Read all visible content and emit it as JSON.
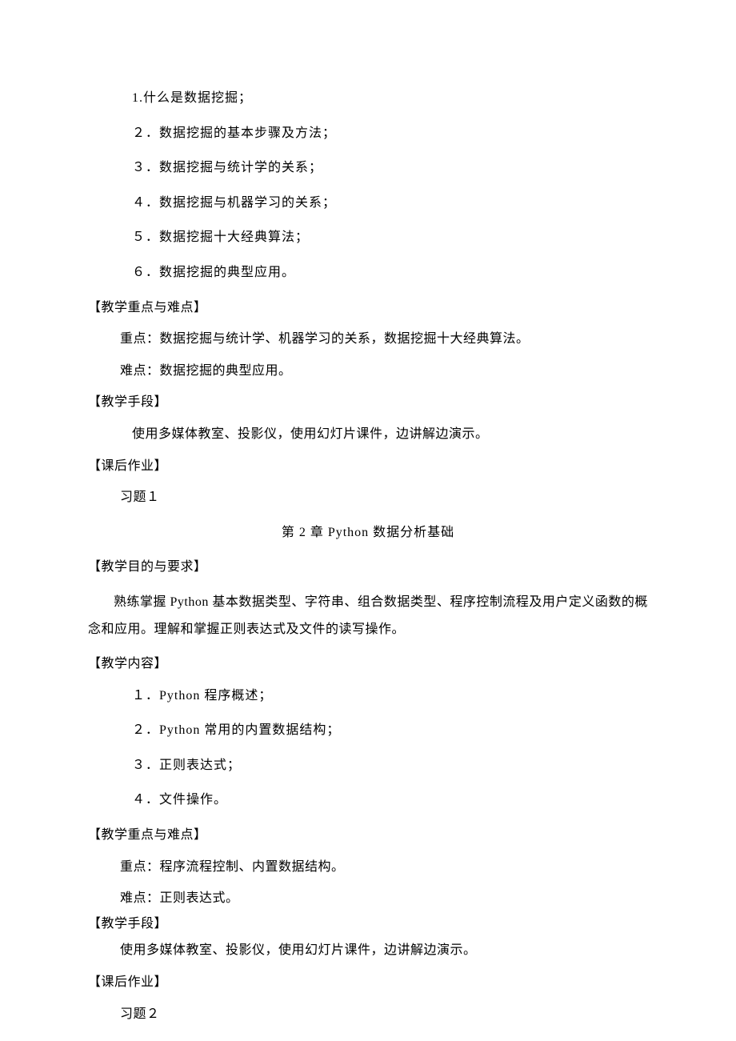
{
  "ch1": {
    "contents": [
      "1.什么是数据挖掘；",
      "２．数据挖掘的基本步骤及方法；",
      "３．数据挖掘与统计学的关系；",
      "４．数据挖掘与机器学习的关系；",
      "５．数据挖掘十大经典算法；",
      "６．数据挖掘的典型应用。"
    ],
    "focus_label": "【教学重点与难点】",
    "focus_key": "重点：数据挖掘与统计学、机器学习的关系，数据挖掘十大经典算法。",
    "focus_difficult": "难点：数据挖掘的典型应用。",
    "method_label": "【教学手段】",
    "method_text": "使用多媒体教室、投影仪，使用幻灯片课件，边讲解边演示。",
    "homework_label": "【课后作业】",
    "homework_text": "习题１"
  },
  "ch2": {
    "title": "第 2 章 Python 数据分析基础",
    "objective_label": "【教学目的与要求】",
    "objective_text": "熟练掌握 Python 基本数据类型、字符串、组合数据类型、程序控制流程及用户定义函数的概念和应用。理解和掌握正则表达式及文件的读写操作。",
    "content_label": "【教学内容】",
    "contents": [
      "１．Python 程序概述；",
      "２．Python 常用的内置数据结构；",
      "３．正则表达式；",
      "４．文件操作。"
    ],
    "focus_label": "【教学重点与难点】",
    "focus_key": "重点：程序流程控制、内置数据结构。",
    "focus_difficult": "难点：正则表达式。",
    "method_label": "【教学手段】",
    "method_text": "使用多媒体教室、投影仪，使用幻灯片课件，边讲解边演示。",
    "homework_label": "【课后作业】",
    "homework_text": "习题２"
  }
}
